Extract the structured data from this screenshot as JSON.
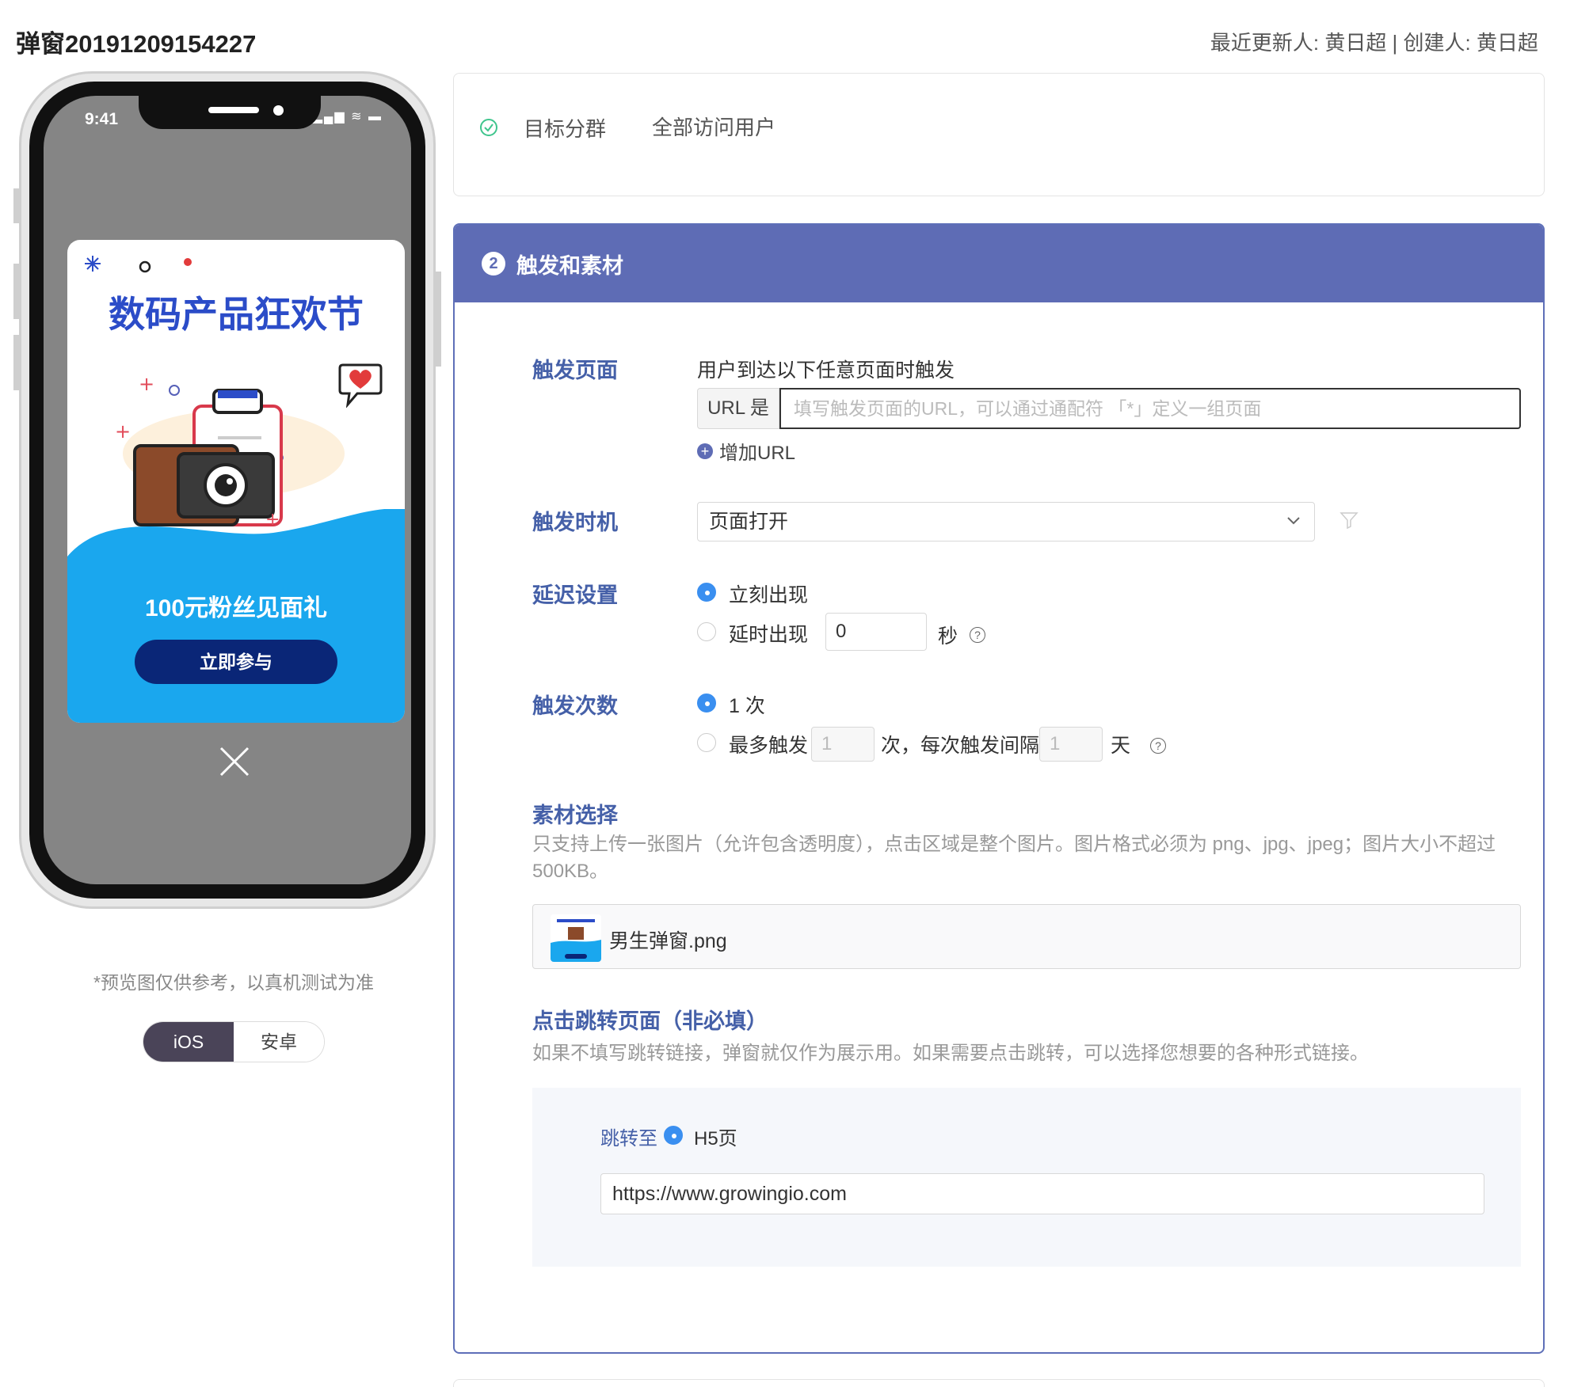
{
  "page": {
    "title": "弹窗20191209154227",
    "meta": "最近更新人: 黄日超 |  创建人: 黄日超"
  },
  "preview": {
    "status_time": "9:41",
    "status_icons": "▂▄▆ ≋ ▬",
    "popup_title": "数码产品狂欢节",
    "popup_subtitle": "100元粉丝见面礼",
    "popup_button": "立即参与",
    "note": "*预览图仅供参考，以真机测试为准",
    "platforms": [
      "iOS",
      "安卓"
    ],
    "selected_platform": "iOS",
    "colors": {
      "popup_blue": "#1aa7ee",
      "title_blue": "#2b4cc8",
      "button_navy": "#0a2677",
      "screen_gray": "#858585"
    }
  },
  "target": {
    "label": "目标分群",
    "value": "全部访问用户"
  },
  "section": {
    "step": "2",
    "title": "触发和素材",
    "header_color": "#5e6cb5"
  },
  "trigger_page": {
    "label": "触发页面",
    "desc": "用户到达以下任意页面时触发",
    "url_prefix": "URL 是",
    "url_placeholder": "填写触发页面的URL，可以通过通配符 「*」定义一组页面",
    "add_url": "增加URL"
  },
  "trigger_timing": {
    "label": "触发时机",
    "selected": "页面打开"
  },
  "delay": {
    "label": "延迟设置",
    "option_now": "立刻出现",
    "option_delay": "延时出现",
    "delay_value": "0",
    "unit": "秒",
    "help": "?"
  },
  "frequency": {
    "label": "触发次数",
    "option_once": "1 次",
    "option_max_prefix": "最多触发",
    "max_value": "1",
    "option_max_mid": "次，每次触发间隔",
    "interval_value": "1",
    "unit": "天",
    "help": "?"
  },
  "material": {
    "label": "素材选择",
    "hint": "只支持上传一张图片（允许包含透明度），点击区域是整个图片。图片格式必须为 png、jpg、jpeg；图片大小不超过 500KB。",
    "file_name": "男生弹窗.png"
  },
  "jump": {
    "label": "点击跳转页面（非必填）",
    "hint": "如果不填写跳转链接，弹窗就仅作为展示用。如果需要点击跳转，可以选择您想要的各种形式链接。",
    "to_label": "跳转至",
    "type": "H5页",
    "url": "https://www.growingio.com"
  }
}
